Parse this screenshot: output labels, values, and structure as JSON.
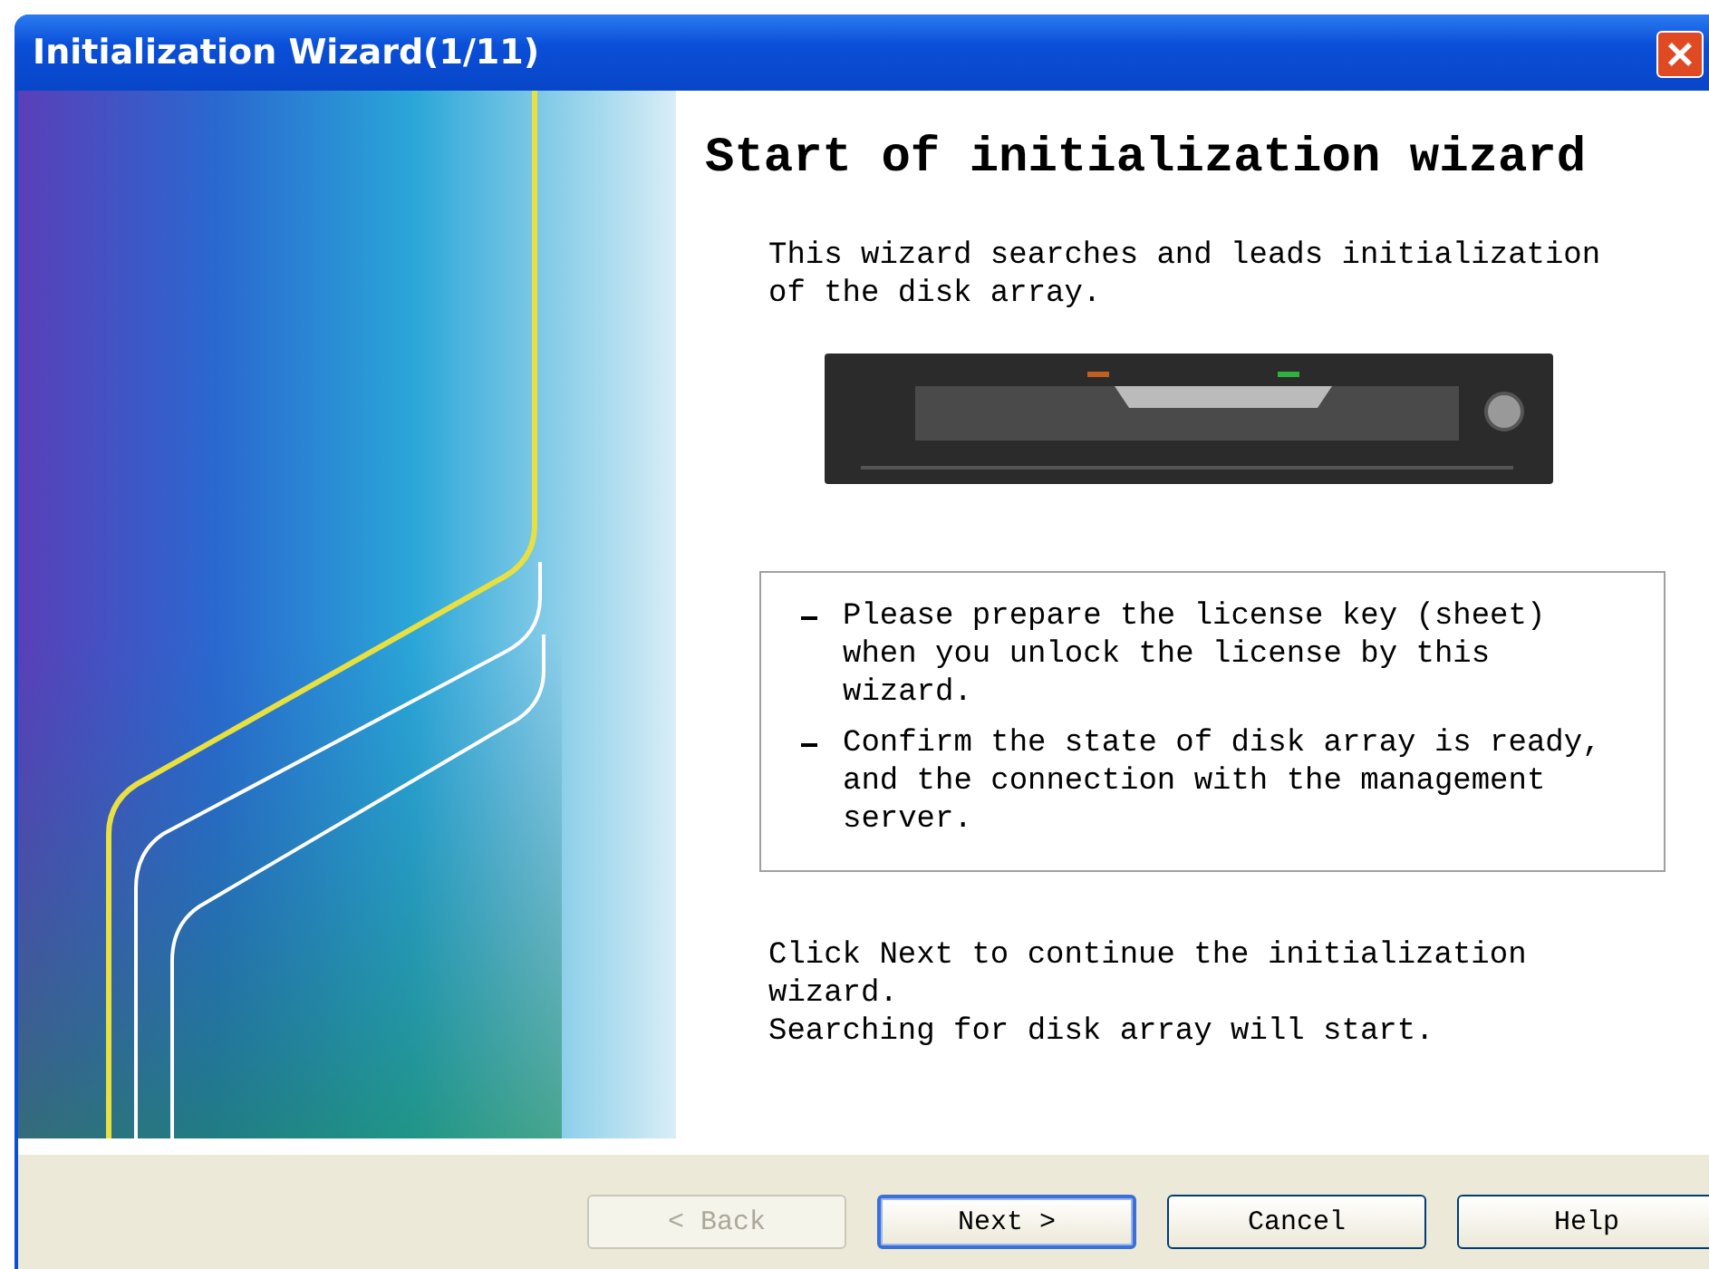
{
  "window": {
    "title": "Initialization Wizard(1/11)"
  },
  "heading": "Start of initialization wizard",
  "intro": "This wizard searches and leads initialization of the disk array.",
  "notes": [
    "Please prepare the license key (sheet) when you unlock the license by this wizard.",
    "Confirm the state of disk array is ready, and the connection with the management server."
  ],
  "footer_lines": [
    "Click Next to continue the initialization wizard.",
    "Searching for disk array will start."
  ],
  "buttons": [
    {
      "label": "< Back",
      "disabled": true,
      "default": false
    },
    {
      "label": "Next >",
      "disabled": false,
      "default": true
    },
    {
      "label": "Cancel",
      "disabled": false,
      "default": false
    },
    {
      "label": "Help",
      "disabled": false,
      "default": false
    }
  ]
}
